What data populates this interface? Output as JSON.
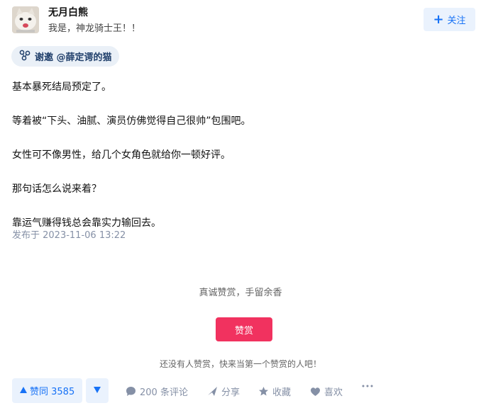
{
  "author": {
    "name": "无月白熊",
    "bio": "我是，神龙骑士王！！",
    "avatar": "cat-photo"
  },
  "follow": {
    "label": "关注",
    "icon": "plus-icon"
  },
  "invite": {
    "label": "谢邀 @薛定谔的猫",
    "icon": "invite-icon"
  },
  "content": {
    "paragraphs": [
      "基本暴死结局预定了。",
      "等着被“下头、油腻、演员仿佛觉得自己很帅”包围吧。",
      "女性可不像男性，给几个女角色就给你一顿好评。",
      "那句话怎么说来着？",
      "靠运气赚得钱总会靠实力输回去。"
    ],
    "publish_time": "发布于 2023-11-06 13:22"
  },
  "reward": {
    "slogan": "真诚赞赏，手留余香",
    "button": "赞赏",
    "empty_hint": "还没有人赞赏，快来当第一个赞赏的人吧！"
  },
  "actions": {
    "vote_up": "赞同 3585",
    "comments": "200 条评论",
    "share": "分享",
    "favorite": "收藏",
    "like": "喜欢"
  },
  "colors": {
    "accent": "#1772f6",
    "reward": "#f1325f",
    "muted": "#8590a6"
  }
}
